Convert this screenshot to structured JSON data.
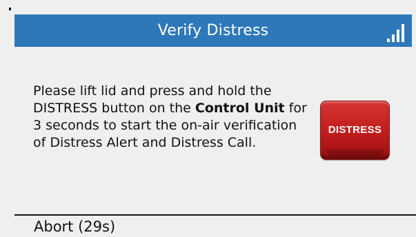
{
  "header": {
    "title": "Verify Distress",
    "signal_icon": "signal-strength-icon"
  },
  "message": {
    "part1": "Please lift lid and press and hold the DISTRESS button on the ",
    "bold": "Control Unit",
    "part2": " for 3 seconds to start the on-air verification of Distress Alert and Distress Call."
  },
  "distress_button": {
    "label": "DISTRESS",
    "color": "#c01c1c"
  },
  "footer": {
    "abort_label": "Abort (29s)"
  },
  "colors": {
    "header_bg": "#2e78b9",
    "screen_bg": "#efefef"
  }
}
